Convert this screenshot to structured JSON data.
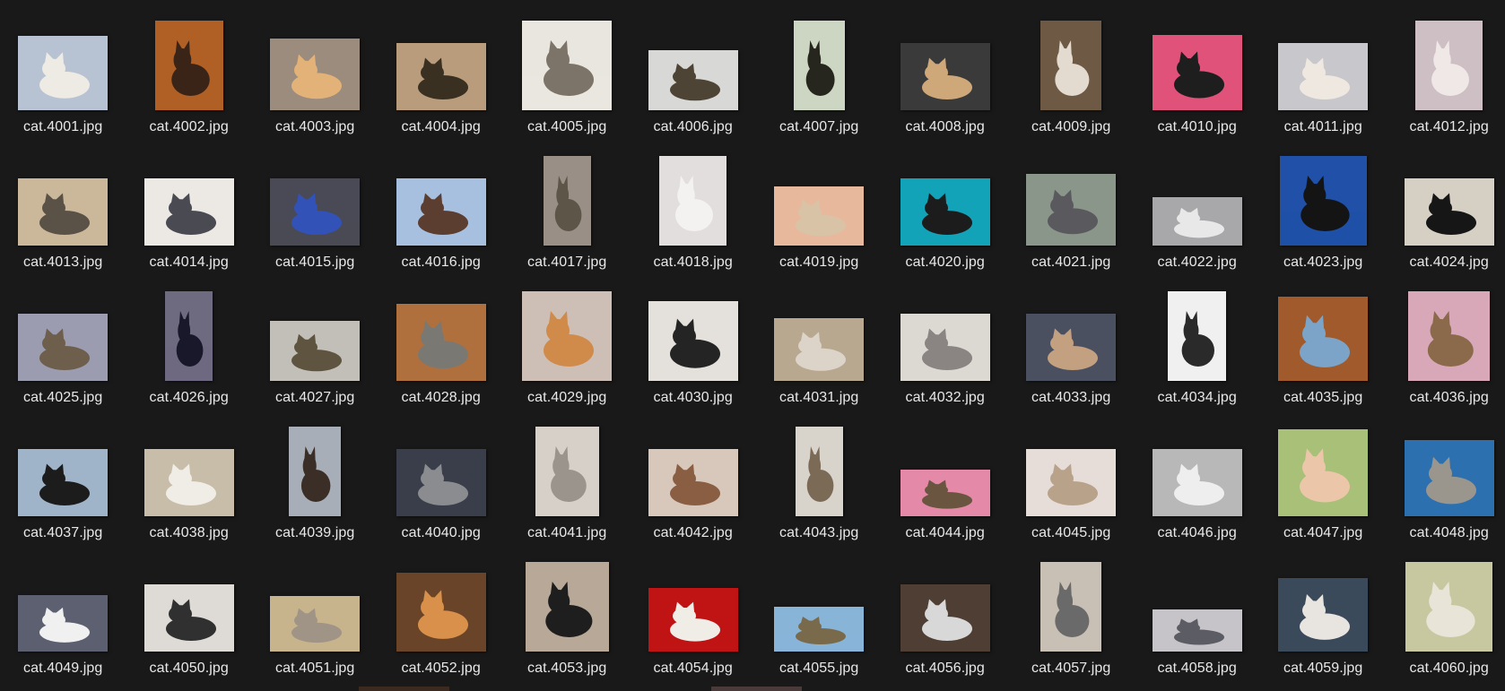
{
  "files": [
    {
      "name": "cat.4001.jpg",
      "palette": [
        "#b7c3d3",
        "#eeeae4"
      ]
    },
    {
      "name": "cat.4002.jpg",
      "palette": [
        "#b06025",
        "#3a2418"
      ]
    },
    {
      "name": "cat.4003.jpg",
      "palette": [
        "#9c8c7e",
        "#e3b278"
      ]
    },
    {
      "name": "cat.4004.jpg",
      "palette": [
        "#b89c7c",
        "#3a3022"
      ]
    },
    {
      "name": "cat.4005.jpg",
      "palette": [
        "#e9e6e0",
        "#7c7468"
      ]
    },
    {
      "name": "cat.4006.jpg",
      "palette": [
        "#d8d8d6",
        "#4e4436"
      ]
    },
    {
      "name": "cat.4007.jpg",
      "palette": [
        "#cdd6c2",
        "#26261e"
      ]
    },
    {
      "name": "cat.4008.jpg",
      "palette": [
        "#3a3a3a",
        "#cfa87a"
      ]
    },
    {
      "name": "cat.4009.jpg",
      "palette": [
        "#6e5a44",
        "#e4dbd0"
      ]
    },
    {
      "name": "cat.4010.jpg",
      "palette": [
        "#e0527a",
        "#1e1e1e"
      ]
    },
    {
      "name": "cat.4011.jpg",
      "palette": [
        "#c8c8cc",
        "#efe8e0"
      ]
    },
    {
      "name": "cat.4012.jpg",
      "palette": [
        "#cdbfc3",
        "#efe8e6"
      ]
    },
    {
      "name": "cat.4013.jpg",
      "palette": [
        "#cbb89a",
        "#5a5246"
      ]
    },
    {
      "name": "cat.4014.jpg",
      "palette": [
        "#ece8e4",
        "#4a4a52"
      ]
    },
    {
      "name": "cat.4015.jpg",
      "palette": [
        "#4a4a56",
        "#3252b8"
      ]
    },
    {
      "name": "cat.4016.jpg",
      "palette": [
        "#a8c0e0",
        "#5c3e30"
      ]
    },
    {
      "name": "cat.4017.jpg",
      "palette": [
        "#9a8f86",
        "#5c5548"
      ]
    },
    {
      "name": "cat.4018.jpg",
      "palette": [
        "#e2dede",
        "#f4f2f0"
      ]
    },
    {
      "name": "cat.4019.jpg",
      "palette": [
        "#e8b89c",
        "#d9c3a6"
      ]
    },
    {
      "name": "cat.4020.jpg",
      "palette": [
        "#12a3b8",
        "#1c1c1c"
      ]
    },
    {
      "name": "cat.4021.jpg",
      "palette": [
        "#8a968a",
        "#5a5a5e"
      ]
    },
    {
      "name": "cat.4022.jpg",
      "palette": [
        "#a8a8aa",
        "#e8e8e8"
      ]
    },
    {
      "name": "cat.4023.jpg",
      "palette": [
        "#2050a8",
        "#141414"
      ]
    },
    {
      "name": "cat.4024.jpg",
      "palette": [
        "#d6cfc4",
        "#161616"
      ]
    },
    {
      "name": "cat.4025.jpg",
      "palette": [
        "#9c9cb0",
        "#6e5e4c"
      ]
    },
    {
      "name": "cat.4026.jpg",
      "palette": [
        "#6e6a80",
        "#18182a"
      ]
    },
    {
      "name": "cat.4027.jpg",
      "palette": [
        "#c2bfb8",
        "#5e5440"
      ]
    },
    {
      "name": "cat.4028.jpg",
      "palette": [
        "#b0703e",
        "#7a7872"
      ]
    },
    {
      "name": "cat.4029.jpg",
      "palette": [
        "#cdbfb6",
        "#d08a4a"
      ]
    },
    {
      "name": "cat.4030.jpg",
      "palette": [
        "#e4e0dc",
        "#242424"
      ]
    },
    {
      "name": "cat.4031.jpg",
      "palette": [
        "#b8a890",
        "#dcd4c8"
      ]
    },
    {
      "name": "cat.4032.jpg",
      "palette": [
        "#dcd8d2",
        "#8a8482"
      ]
    },
    {
      "name": "cat.4033.jpg",
      "palette": [
        "#4a5060",
        "#c2a080"
      ]
    },
    {
      "name": "cat.4034.jpg",
      "palette": [
        "#f0f0f0",
        "#2a2a2a"
      ]
    },
    {
      "name": "cat.4035.jpg",
      "palette": [
        "#a05a2c",
        "#7ca4c8"
      ]
    },
    {
      "name": "cat.4036.jpg",
      "palette": [
        "#d8a8b8",
        "#8a6a4a"
      ]
    },
    {
      "name": "cat.4037.jpg",
      "palette": [
        "#9fb4c8",
        "#1c1c1c"
      ]
    },
    {
      "name": "cat.4038.jpg",
      "palette": [
        "#c8bda8",
        "#f0ece6"
      ]
    },
    {
      "name": "cat.4039.jpg",
      "palette": [
        "#a8aeb8",
        "#3a2e26"
      ]
    },
    {
      "name": "cat.4040.jpg",
      "palette": [
        "#3a3e4a",
        "#8a8c90"
      ]
    },
    {
      "name": "cat.4041.jpg",
      "palette": [
        "#d6d0c8",
        "#9a948c"
      ]
    },
    {
      "name": "cat.4042.jpg",
      "palette": [
        "#d8c8bc",
        "#8a5e42"
      ]
    },
    {
      "name": "cat.4043.jpg",
      "palette": [
        "#d8d4cc",
        "#7a6a56"
      ]
    },
    {
      "name": "cat.4044.jpg",
      "palette": [
        "#e48aa8",
        "#6a5640"
      ]
    },
    {
      "name": "cat.4045.jpg",
      "palette": [
        "#e6dcd8",
        "#b8a28a"
      ]
    },
    {
      "name": "cat.4046.jpg",
      "palette": [
        "#b8b8b8",
        "#eeeeee"
      ]
    },
    {
      "name": "cat.4047.jpg",
      "palette": [
        "#a8c078",
        "#ecc6a8"
      ]
    },
    {
      "name": "cat.4048.jpg",
      "palette": [
        "#2c70b0",
        "#9a968e"
      ]
    },
    {
      "name": "cat.4049.jpg",
      "palette": [
        "#5c6070",
        "#f0f0f0"
      ]
    },
    {
      "name": "cat.4050.jpg",
      "palette": [
        "#dedad6",
        "#303030"
      ]
    },
    {
      "name": "cat.4051.jpg",
      "palette": [
        "#c8b48c",
        "#a09486"
      ]
    },
    {
      "name": "cat.4052.jpg",
      "palette": [
        "#6a4428",
        "#d8904a"
      ]
    },
    {
      "name": "cat.4053.jpg",
      "palette": [
        "#b8a898",
        "#1e1e1e"
      ]
    },
    {
      "name": "cat.4054.jpg",
      "palette": [
        "#c01414",
        "#f0ece6"
      ]
    },
    {
      "name": "cat.4055.jpg",
      "palette": [
        "#88b4d8",
        "#7a6a4c"
      ]
    },
    {
      "name": "cat.4056.jpg",
      "palette": [
        "#4e3e34",
        "#d8d8d8"
      ]
    },
    {
      "name": "cat.4057.jpg",
      "palette": [
        "#c8c0b4",
        "#6a6a6a"
      ]
    },
    {
      "name": "cat.4058.jpg",
      "palette": [
        "#c6c4c8",
        "#5c5c64"
      ]
    },
    {
      "name": "cat.4059.jpg",
      "palette": [
        "#3a4a5a",
        "#e8e4e0"
      ]
    },
    {
      "name": "cat.4060.jpg",
      "palette": [
        "#c8c8a0",
        "#e8e4d8"
      ]
    }
  ]
}
